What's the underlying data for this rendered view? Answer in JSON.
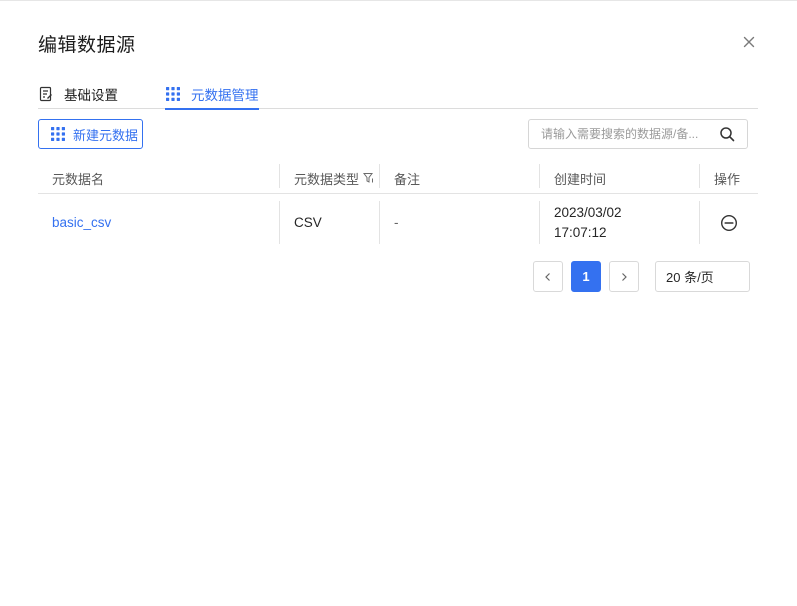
{
  "dialog": {
    "title": "编辑数据源",
    "close_icon": "close-icon"
  },
  "tabs": [
    {
      "label": "基础设置",
      "icon": "document-edit-icon",
      "active": false
    },
    {
      "label": "元数据管理",
      "icon": "grid-icon",
      "active": true
    }
  ],
  "toolbar": {
    "new_label": "新建元数据",
    "new_icon": "grid-icon",
    "search_placeholder": "请输入需要搜索的数据源/备...",
    "search_value": ""
  },
  "table": {
    "columns": [
      "元数据名",
      "元数据类型",
      "备注",
      "创建时间",
      "操作"
    ],
    "rows": [
      {
        "name": "basic_csv",
        "type": "CSV",
        "remark": "-",
        "created_date": "2023/03/02",
        "created_time": "17:07:12",
        "action_icon": "remove-circle-icon"
      }
    ]
  },
  "pagination": {
    "current_page": "1",
    "page_size": "20 条/页"
  },
  "colors": {
    "accent": "#3471f0",
    "border": "#d9d9d9",
    "header_text": "#595959"
  }
}
